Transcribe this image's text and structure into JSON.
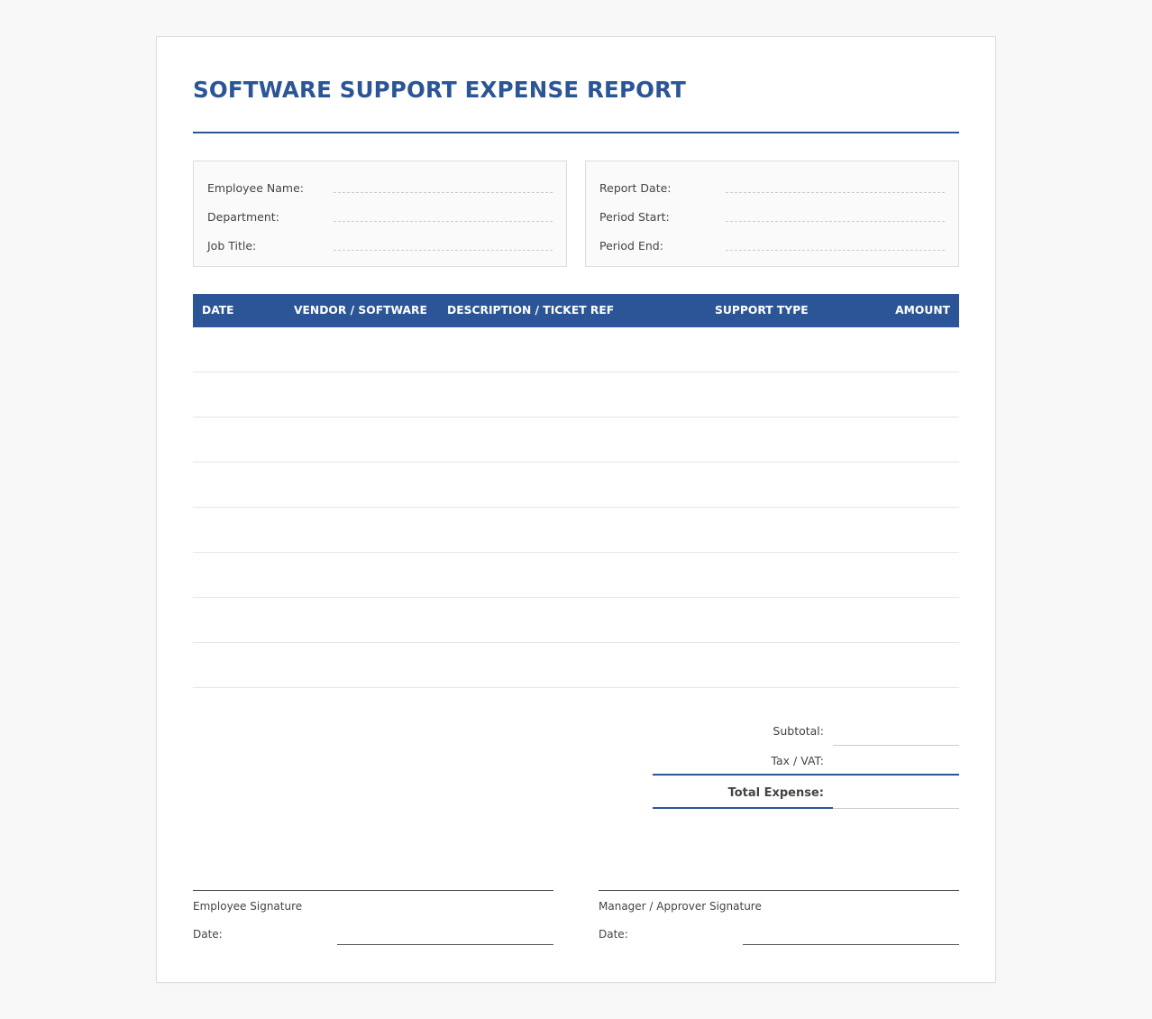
{
  "title": "SOFTWARE SUPPORT EXPENSE REPORT",
  "colors": {
    "accent": "#2c5597",
    "page_background": "#f8f8f8",
    "sheet_background": "#ffffff",
    "text": "#444444"
  },
  "employee_info": {
    "fields": [
      {
        "label": "Employee Name:",
        "value": ""
      },
      {
        "label": "Department:",
        "value": ""
      },
      {
        "label": "Job Title:",
        "value": ""
      }
    ]
  },
  "report_info": {
    "fields": [
      {
        "label": "Report Date:",
        "value": ""
      },
      {
        "label": "Period Start:",
        "value": ""
      },
      {
        "label": "Period End:",
        "value": ""
      }
    ]
  },
  "table": {
    "columns": [
      "DATE",
      "VENDOR / SOFTWARE",
      "DESCRIPTION / TICKET REF",
      "SUPPORT TYPE",
      "AMOUNT"
    ],
    "rows": [
      [
        "",
        "",
        "",
        "",
        ""
      ],
      [
        "",
        "",
        "",
        "",
        ""
      ],
      [
        "",
        "",
        "",
        "",
        ""
      ],
      [
        "",
        "",
        "",
        "",
        ""
      ],
      [
        "",
        "",
        "",
        "",
        ""
      ],
      [
        "",
        "",
        "",
        "",
        ""
      ],
      [
        "",
        "",
        "",
        "",
        ""
      ],
      [
        "",
        "",
        "",
        "",
        ""
      ]
    ]
  },
  "totals": {
    "subtotal_label": "Subtotal:",
    "tax_label": "Tax / VAT:",
    "total_label": "Total Expense:"
  },
  "signatures": {
    "employee_label": "Employee Signature",
    "employee_date_label": "Date:",
    "manager_label": "Manager / Approver Signature",
    "manager_date_label": "Date:"
  }
}
